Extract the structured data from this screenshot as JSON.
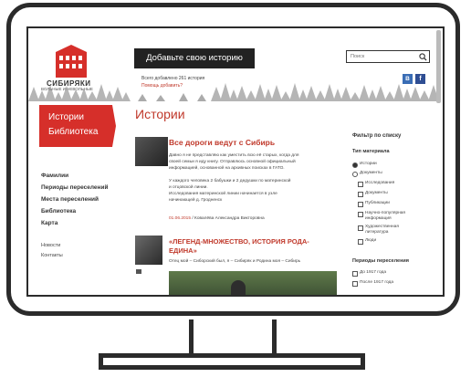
{
  "header": {
    "logo_title": "СИБИРЯКИ",
    "logo_subtitle": "ВОЛЬНЫЕ И НЕВОЛЬНЫЕ",
    "add_story_button": "Добавьте свою историю",
    "count_text": "Всего добавлено 261 история",
    "add_link": "Помощь добавить?",
    "search_placeholder": "Поиск",
    "vk_label": "B",
    "fb_label": "f"
  },
  "sidebar": {
    "banner": [
      "Истории",
      "Библиотека"
    ],
    "nav": [
      "Фамилии",
      "Периоды переселений",
      "Места переселений",
      "Библиотека",
      "Карта"
    ],
    "secondary": [
      "Новости",
      "Контакты"
    ]
  },
  "main": {
    "page_title": "Истории",
    "articles": [
      {
        "title": "Все дороги ведут с Сибирь",
        "lines": [
          "Давно я не представляю как уместить всю её старых, когда для",
          "своей семьи я иду книгу. Отправлюсь основной официальный",
          "информацией, основанной на архивных поисках в ГАТО.",
          "",
          "У каждого человека 2 бабушки и 2 дедушки по материнской",
          "и отцовской линии.",
          "Исследования материнской линии начинается в узле",
          "начинающей д. Гродненск"
        ],
        "date": "01.06.2015",
        "author": "Ковалёва Александра Викторовна"
      },
      {
        "title_lines": [
          "«ЛЕГЕНД-МНОЖЕСТВО, ИСТОРИЯ РОДА-",
          "ЕДИНА»"
        ],
        "lines": [
          "Отец мой – Сиборский был, я – Сибиряк и Родина моя – Сибирь"
        ]
      }
    ]
  },
  "filter": {
    "title": "Фильтр по списку",
    "type_group": "Тип материала",
    "types": [
      {
        "label": "Истории",
        "kind": "radio",
        "checked": true
      },
      {
        "label": "Документы",
        "kind": "radio",
        "checked": false
      },
      {
        "label": "Исследования",
        "kind": "checkbox",
        "checked": false
      },
      {
        "label": "Документы",
        "kind": "checkbox",
        "checked": false
      },
      {
        "label": "Публикации",
        "kind": "checkbox",
        "checked": false
      },
      {
        "label": "Научно-популярная",
        "label2": "информация",
        "kind": "checkbox",
        "checked": false
      },
      {
        "label": "Художественная",
        "label2": "литература",
        "kind": "checkbox",
        "checked": false
      },
      {
        "label": "Люди",
        "kind": "checkbox",
        "checked": false
      }
    ],
    "period_group": "Периоды переселения",
    "periods": [
      "До 1917 года",
      "После 1917 года"
    ]
  }
}
